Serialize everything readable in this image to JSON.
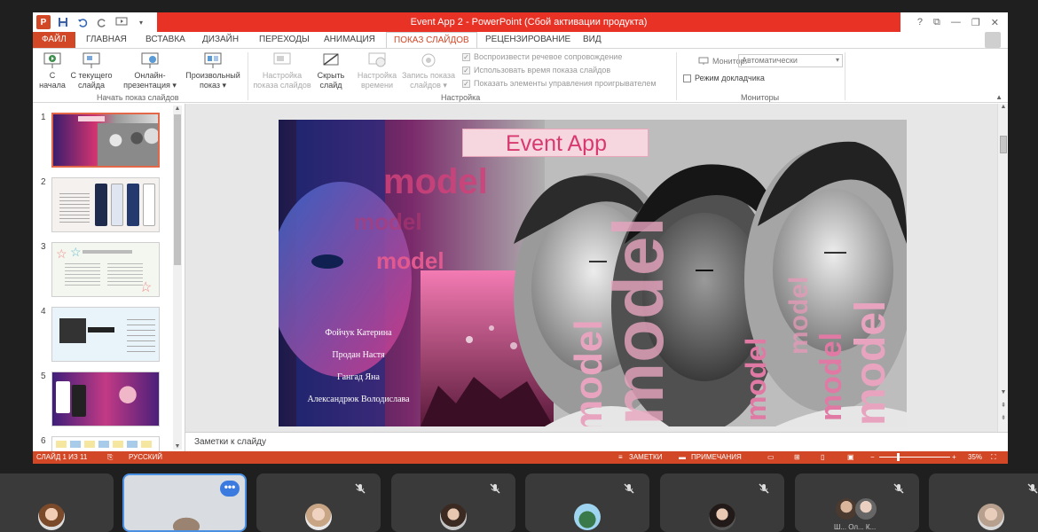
{
  "window": {
    "title": "Event App 2 - PowerPoint (Сбой активации продукта)",
    "controls": [
      "?",
      "⧉",
      "—",
      "❐",
      "✕"
    ]
  },
  "qat": [
    "P",
    "💾",
    "↶",
    "↻",
    "⎘"
  ],
  "tabs": [
    "ФАЙЛ",
    "ГЛАВНАЯ",
    "ВСТАВКА",
    "ДИЗАЙН",
    "ПЕРЕХОДЫ",
    "АНИМАЦИЯ",
    "ПОКАЗ СЛАЙДОВ",
    "РЕЦЕНЗИРОВАНИЕ",
    "ВИД"
  ],
  "ribbon": {
    "start": {
      "from_start": "С\nначала",
      "from_current": "С текущего\nслайда",
      "online": "Онлайн-\nпрезентация",
      "custom": "Произвольный\nпоказ",
      "group": "Начать показ слайдов"
    },
    "setup": {
      "setup_show": "Настройка\nпоказа слайдов",
      "hide_slide": "Скрыть\nслайд",
      "rehearse": "Настройка\nвремени",
      "record": "Запись показа\nслайдов",
      "play_narrations": "Воспроизвести речевое сопровождение",
      "use_timings": "Использовать время показа слайдов",
      "show_controls": "Показать элементы управления проигрывателем",
      "group": "Настройка"
    },
    "monitors": {
      "monitor_label": "Монитор:",
      "monitor_value": "Автоматически",
      "presenter_view": "Режим докладчика",
      "group": "Мониторы"
    }
  },
  "thumbnails": [
    "1",
    "2",
    "3",
    "4",
    "5",
    "6"
  ],
  "slide": {
    "title": "Event App",
    "names": [
      "Фойчук Катерина",
      "Продан Настя",
      "Гангад Яна",
      "Александрюк Володислава"
    ],
    "watermark_word": "model"
  },
  "notes_placeholder": "Заметки к слайду",
  "status": {
    "slide_info": "СЛАЙД 1 ИЗ 11",
    "language": "РУССКИЙ",
    "notes": "ЗАМЕТКИ",
    "comments": "ПРИМЕЧАНИЯ",
    "zoom": "35%"
  },
  "video_tiles": [
    {
      "muted": false,
      "active": false
    },
    {
      "muted": false,
      "active": true,
      "more_label": "•••"
    },
    {
      "muted": true,
      "active": false
    },
    {
      "muted": true,
      "active": false
    },
    {
      "muted": true,
      "active": false
    },
    {
      "muted": true,
      "active": false
    },
    {
      "muted": true,
      "active": false,
      "caption": "Ш... Ол... К..."
    },
    {
      "muted": true,
      "active": false
    }
  ],
  "colors": {
    "accent": "#d24726",
    "title_red": "#e83226",
    "slide_pink": "#e0487e"
  }
}
